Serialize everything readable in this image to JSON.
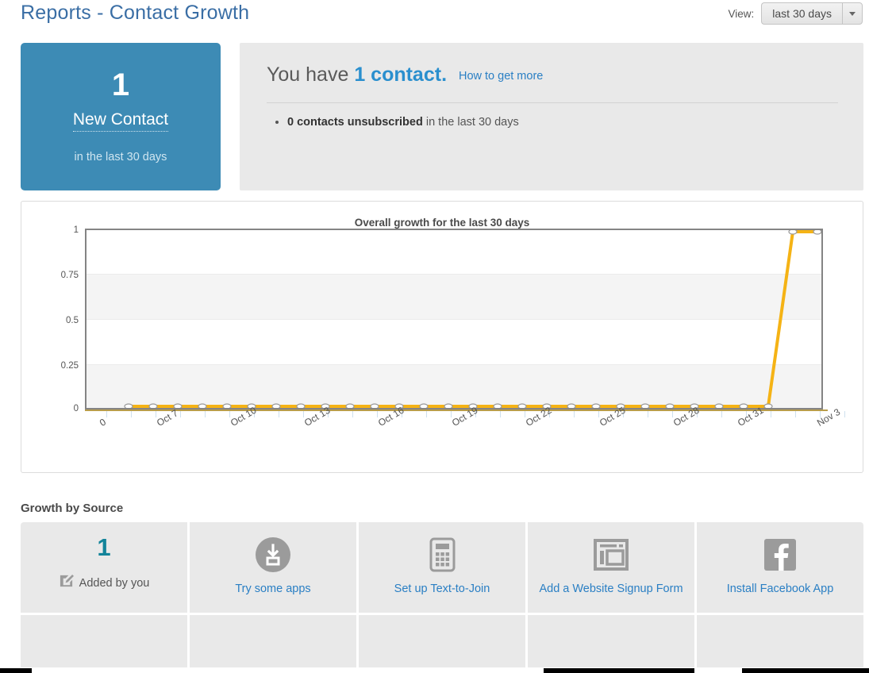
{
  "header": {
    "title": "Reports - Contact Growth",
    "view_label": "View:",
    "view_value": "last 30 days",
    "caret_icon": "chevron-down-icon"
  },
  "stat_card": {
    "number": "1",
    "label": "New Contact",
    "sub": "in the last 30 days",
    "background": "#3d8bb5"
  },
  "info_panel": {
    "lead": "You have",
    "count": "1 contact.",
    "how_to_link": "How to get more",
    "bullets": [
      {
        "strong": "0 contacts unsubscribed",
        "rest": " in the last 30 days"
      }
    ]
  },
  "chart_data": {
    "type": "line",
    "title": "Overall growth for the last 30 days",
    "xlabel": "",
    "ylabel": "",
    "ylim": [
      0,
      1
    ],
    "yticks": [
      "1",
      "0.75",
      "0.5",
      "0.25",
      "0"
    ],
    "grid": true,
    "legend": "none",
    "line_color": "#f5b315",
    "marker": "open-circle",
    "x_tick_labels": [
      "0",
      "Oct 7",
      "Oct 10",
      "Oct 13",
      "Oct 16",
      "Oct 19",
      "Oct 22",
      "Oct 25",
      "Oct 28",
      "Oct 31",
      "Nov 3"
    ],
    "x": [
      "Oct 5",
      "Oct 6",
      "Oct 7",
      "Oct 8",
      "Oct 9",
      "Oct 10",
      "Oct 11",
      "Oct 12",
      "Oct 13",
      "Oct 14",
      "Oct 15",
      "Oct 16",
      "Oct 17",
      "Oct 18",
      "Oct 19",
      "Oct 20",
      "Oct 21",
      "Oct 22",
      "Oct 23",
      "Oct 24",
      "Oct 25",
      "Oct 26",
      "Oct 27",
      "Oct 28",
      "Oct 29",
      "Oct 30",
      "Oct 31",
      "Nov 1",
      "Nov 2",
      "Nov 3"
    ],
    "series": [
      {
        "name": "Overall growth",
        "values": [
          0,
          0,
          0,
          0,
          0,
          0,
          0,
          0,
          0,
          0,
          0,
          0,
          0,
          0,
          0,
          0,
          0,
          0,
          0,
          0,
          0,
          0,
          0,
          0,
          0,
          0,
          0,
          1,
          1,
          1
        ]
      }
    ]
  },
  "growth_by_source": {
    "title": "Growth by Source",
    "tiles": [
      {
        "number": "1",
        "icon": "pencil-edit-icon",
        "label": "Added by you",
        "link": false
      },
      {
        "number": "",
        "icon": "download-circle-icon",
        "label": "Try some apps",
        "link": true
      },
      {
        "number": "",
        "icon": "phone-keypad-icon",
        "label": "Set up Text-to-Join",
        "link": true
      },
      {
        "number": "",
        "icon": "website-window-icon",
        "label": "Add a Website Signup Form",
        "link": true
      },
      {
        "number": "",
        "icon": "facebook-icon",
        "label": "Install Facebook App",
        "link": true
      }
    ]
  },
  "colors": {
    "brand_blue": "#3a6ea5",
    "link_blue": "#2a7fc4",
    "accent_teal": "#13849a",
    "chart_orange": "#f5b315",
    "panel_grey": "#e9e9e9"
  }
}
